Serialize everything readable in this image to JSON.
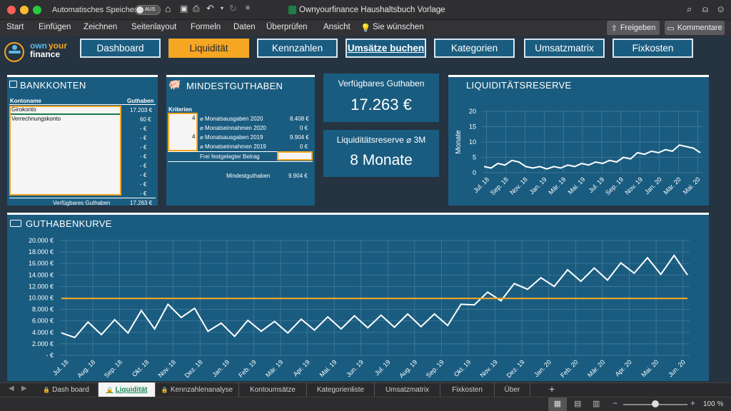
{
  "titlebar": {
    "autosave_label": "Automatisches Speichern",
    "autosave_state": "AUS",
    "doc_title": "Ownyourfinance Haushaltsbuch Vorlage"
  },
  "menu": [
    "Start",
    "Einfügen",
    "Zeichnen",
    "Seitenlayout",
    "Formeln",
    "Daten",
    "Überprüfen",
    "Ansicht",
    "Sie wünschen"
  ],
  "ribbon": {
    "share": "Freigeben",
    "comments": "Kommentare"
  },
  "logo": {
    "own": "own",
    "your": "your",
    "finance": "finance"
  },
  "nav": [
    {
      "label": "Dashboard",
      "active": false
    },
    {
      "label": "Liquidität",
      "active": true
    },
    {
      "label": "Kennzahlen",
      "active": false
    },
    {
      "label": "Umsätze buchen",
      "active": false
    },
    {
      "label": "Kategorien",
      "active": false
    },
    {
      "label": "Umsatzmatrix",
      "active": false
    },
    {
      "label": "Fixkosten",
      "active": false
    }
  ],
  "bankkonten": {
    "title": "BANKKONTEN",
    "col_name": "Kontoname",
    "col_balance": "Guthaben",
    "accounts": [
      {
        "name": "Girokonto",
        "balance": "17.203 €"
      },
      {
        "name": "Verrechnungskonto",
        "balance": "60 €"
      }
    ],
    "empty_cells": [
      "-  €",
      "-  €",
      "-  €",
      "-  €",
      "-  €",
      "-  €",
      "-  €",
      "-  €"
    ],
    "total_label": "Verfügbares Guthaben",
    "total": "17.263 €"
  },
  "mindestguthaben": {
    "title": "MINDESTGUTHABEN",
    "kriterien": "Kriterien",
    "rows": [
      {
        "factor": "4",
        "label": "⌀ Monatsausgaben 2020",
        "value": "8.408 €"
      },
      {
        "factor": "",
        "label": "⌀ Monatseinnahmen 2020",
        "value": "0 €"
      },
      {
        "factor": "4",
        "label": "⌀ Monatsausgaben 2019",
        "value": "9.904 €"
      },
      {
        "factor": "",
        "label": "⌀ Monatseinnahmen 2019",
        "value": "0 €"
      }
    ],
    "frei": "Frei festgelegter Betrag",
    "result_label": "Mindestguthaben",
    "result": "9.904 €"
  },
  "verfuegbar": {
    "title": "Verfügbares Guthaben",
    "value": "17.263 €"
  },
  "reserve_kpi": {
    "title": "Liquiditätsreserve ⌀ 3M",
    "value": "8 Monate"
  },
  "colors": {
    "panel": "#1a5c80",
    "accent": "#f5a623",
    "bg": "#263340"
  },
  "chart_data": [
    {
      "type": "line",
      "title": "LIQUIDITÄTSRESERVE",
      "ylabel": "Monate",
      "ylim": [
        0,
        20
      ],
      "yticks": [
        "0",
        "5",
        "10",
        "15",
        "20"
      ],
      "x": [
        "Jul. 18",
        "Sep. 18",
        "Nov. 18",
        "Jan. 19",
        "Mär. 19",
        "Mai. 19",
        "Jul. 19",
        "Sep. 19",
        "Nov. 19",
        "Jan. 20",
        "Mär. 20",
        "Mai. 20"
      ],
      "values": [
        2,
        1.5,
        3,
        2.5,
        4,
        3.5,
        2,
        1.5,
        2,
        1.2,
        2,
        1.5,
        2.5,
        2,
        3,
        2.5,
        3.5,
        3,
        4,
        3.5,
        5,
        4.5,
        6.5,
        6,
        7,
        6.5,
        7.5,
        7,
        9,
        8.5,
        8,
        6.5
      ]
    },
    {
      "type": "line",
      "title": "GUTHABENKURVE",
      "ylim": [
        0,
        20000
      ],
      "yticks": [
        "-  €",
        "2.000 €",
        "4.000 €",
        "6.000 €",
        "8.000 €",
        "10.000 €",
        "12.000 €",
        "14.000 €",
        "16.000 €",
        "18.000 €",
        "20.000 €"
      ],
      "x": [
        "Jul. 18",
        "Aug. 18",
        "Sep. 18",
        "Okt. 18",
        "Nov. 18",
        "Dez. 18",
        "Jan. 19",
        "Feb. 19",
        "Mär. 19",
        "Apr. 19",
        "Mai. 19",
        "Jun. 19",
        "Jul. 19",
        "Aug. 19",
        "Sep. 19",
        "Okt. 19",
        "Nov. 19",
        "Dez. 19",
        "Jan. 20",
        "Feb. 20",
        "Mär. 20",
        "Apr. 20",
        "Mai. 20",
        "Jun. 20"
      ],
      "series": [
        {
          "values": [
            3900,
            3100,
            5800,
            3600,
            6200,
            3900,
            7800,
            4600,
            8900,
            6600,
            8200,
            4200,
            5600,
            3300,
            6100,
            4200,
            5900,
            3900,
            6300,
            4400,
            6700,
            4600,
            6900,
            4800,
            7000,
            4900,
            7200,
            5000,
            7200,
            5200,
            8900,
            8800,
            11000,
            9500,
            12500,
            11500,
            13500,
            12000,
            14900,
            12900,
            15200,
            13100,
            16100,
            14300,
            17000,
            14100,
            17400,
            14000
          ]
        },
        {
          "values": [
            9900,
            9900
          ]
        }
      ]
    }
  ],
  "tabs": [
    {
      "label": "Dash board",
      "locked": true,
      "active": false
    },
    {
      "label": "Liquidität",
      "locked": true,
      "active": true
    },
    {
      "label": "Kennzahlenanalyse",
      "locked": true,
      "active": false
    },
    {
      "label": "Kontoumsätze",
      "locked": false,
      "active": false
    },
    {
      "label": "Kategorienliste",
      "locked": false,
      "active": false
    },
    {
      "label": "Umsatzmatrix",
      "locked": false,
      "active": false
    },
    {
      "label": "Fixkosten",
      "locked": false,
      "active": false
    },
    {
      "label": "Über",
      "locked": false,
      "active": false
    }
  ],
  "status": {
    "zoom": "100 %"
  }
}
